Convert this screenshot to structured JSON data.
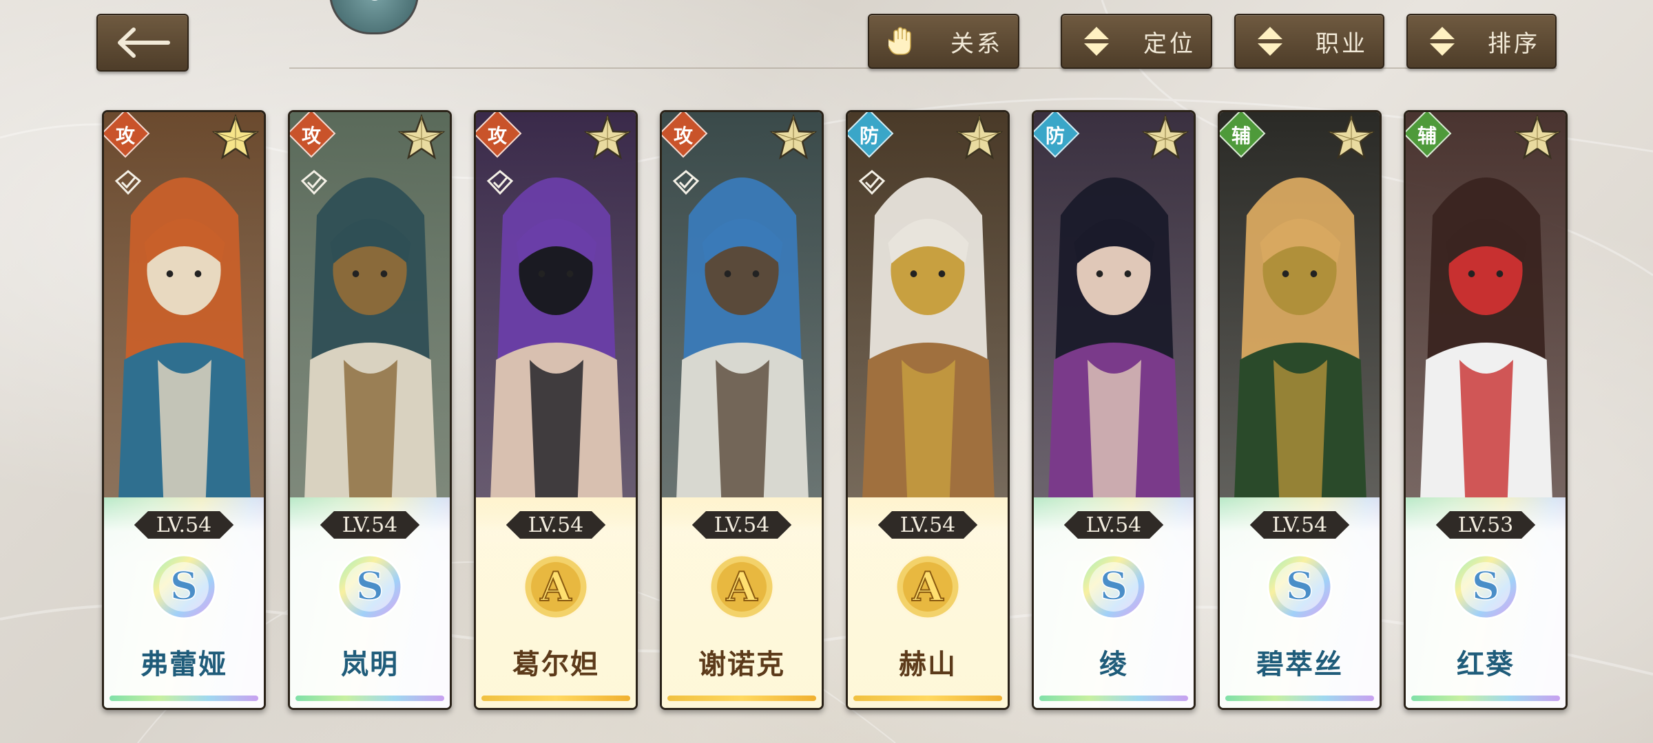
{
  "header": {
    "filters": [
      {
        "label": "关系",
        "icon": "glove-icon"
      },
      {
        "label": "定位",
        "icon": "sort-arrows-icon"
      },
      {
        "label": "职业",
        "icon": "sort-arrows-icon"
      },
      {
        "label": "排序",
        "icon": "sort-arrows-icon"
      }
    ]
  },
  "colors": {
    "attack_role": "#c9532a",
    "defense_role": "#3aa6c8",
    "support_role": "#4e9a3a",
    "button_brown": "#5e4a33"
  },
  "characters": [
    {
      "name": "弗蕾娅",
      "role": "攻",
      "level": "LV.54",
      "rank": "S",
      "checked": true,
      "star_bright": true
    },
    {
      "name": "岚明",
      "role": "攻",
      "level": "LV.54",
      "rank": "S",
      "checked": true,
      "star_bright": false
    },
    {
      "name": "葛尔妲",
      "role": "攻",
      "level": "LV.54",
      "rank": "A",
      "checked": true,
      "star_bright": false
    },
    {
      "name": "谢诺克",
      "role": "攻",
      "level": "LV.54",
      "rank": "A",
      "checked": true,
      "star_bright": false
    },
    {
      "name": "赫山",
      "role": "防",
      "level": "LV.54",
      "rank": "A",
      "checked": true,
      "star_bright": false
    },
    {
      "name": "绫",
      "role": "防",
      "level": "LV.54",
      "rank": "S",
      "checked": false,
      "star_bright": false
    },
    {
      "name": "碧萃丝",
      "role": "辅",
      "level": "LV.54",
      "rank": "S",
      "checked": false,
      "star_bright": false
    },
    {
      "name": "红葵",
      "role": "辅",
      "level": "LV.53",
      "rank": "S",
      "checked": false,
      "star_bright": false
    }
  ]
}
